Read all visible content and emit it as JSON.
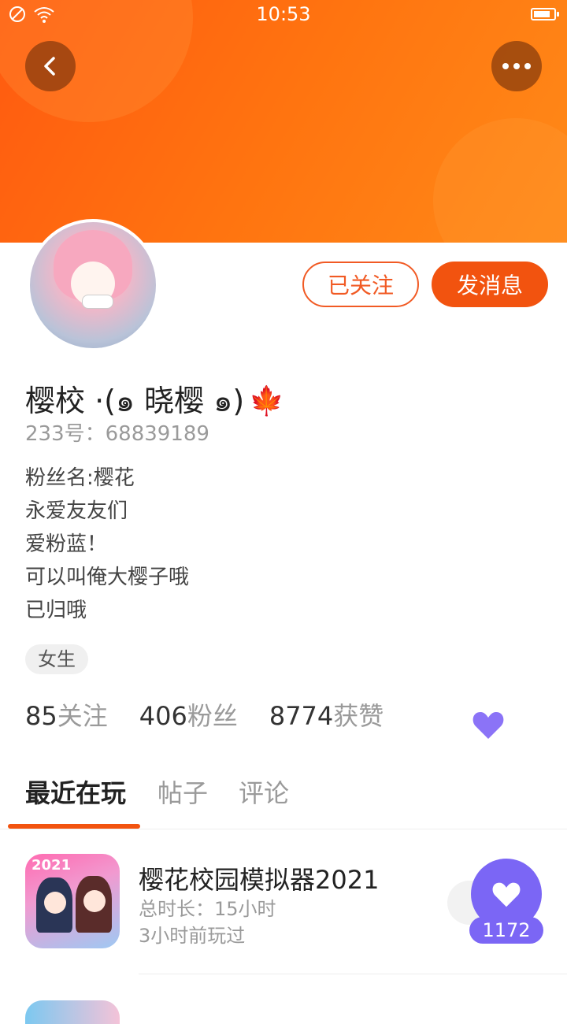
{
  "status_bar": {
    "time": "10:53"
  },
  "profile": {
    "nickname": "樱校 ·(๑ 晓樱 ๑)",
    "nickname_emoji": "🍁",
    "uid": "233号：68839189",
    "bio": [
      "粉丝名:樱花",
      "永爱友友们",
      "爱粉蓝！",
      "可以叫俺大樱子哦",
      "已归哦"
    ],
    "gender": "女生"
  },
  "actions": {
    "follow_label": "已关注",
    "message_label": "发消息"
  },
  "stats": [
    {
      "value": "85",
      "label": "关注"
    },
    {
      "value": "406",
      "label": "粉丝"
    },
    {
      "value": "8774",
      "label": "获赞"
    }
  ],
  "tabs": [
    {
      "label": "最近在玩",
      "active": true
    },
    {
      "label": "帖子",
      "active": false
    },
    {
      "label": "评论",
      "active": false
    }
  ],
  "games": [
    {
      "title": "樱花校园模拟器2021",
      "icon_text": "2021",
      "duration": "总时长：15小时",
      "last_played": "3小时前玩过"
    }
  ],
  "like": {
    "count": "1172"
  },
  "colors": {
    "accent": "#f2530f",
    "like_purple": "#7b66f5"
  },
  "icons": [
    "back-arrow-icon",
    "more-dots-icon",
    "heart-icon",
    "maple-leaf-icon"
  ]
}
